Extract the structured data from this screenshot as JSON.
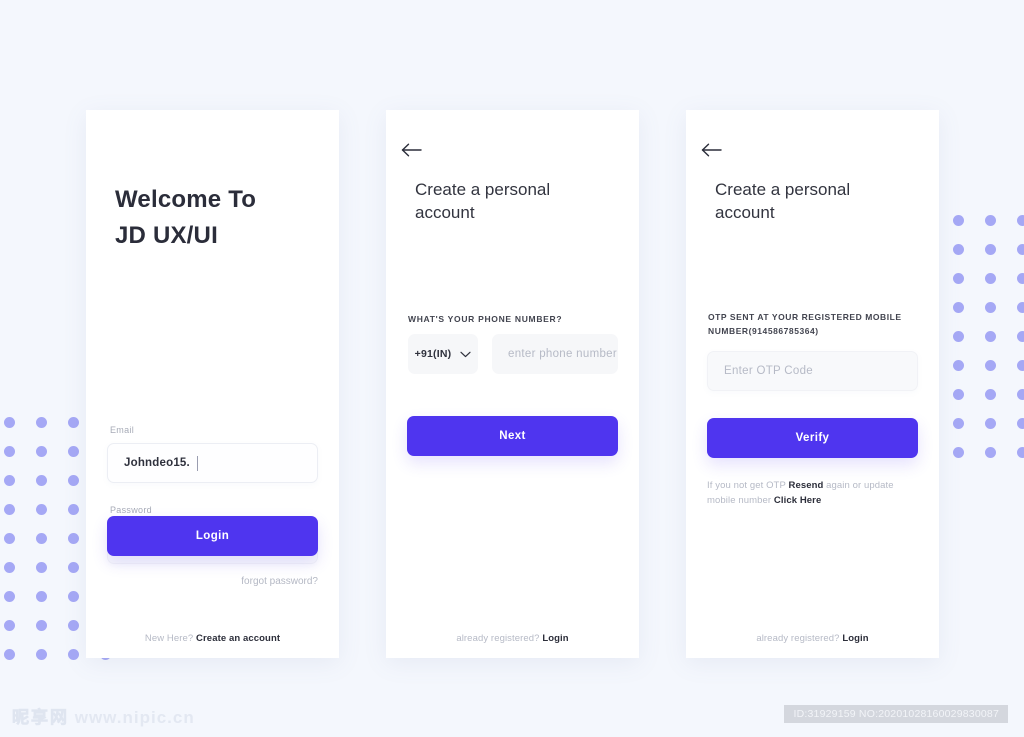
{
  "theme": {
    "accent": "#4f35ef",
    "background": "#f4f7fd",
    "card_background": "#ffffff",
    "dot_color": "#a5a8f5",
    "text_dark": "#2b2d3a",
    "text_muted": "#b6bac6"
  },
  "screens": {
    "login": {
      "title": "Welcome To\nJD UX/UI",
      "title_line1": "Welcome To",
      "title_line2": "JD UX/UI",
      "email": {
        "label": "Email",
        "value": "Johndeo15."
      },
      "password": {
        "label": "Password",
        "placeholder": "Password",
        "value": ""
      },
      "forgot_label": "forgot password?",
      "submit_label": "Login",
      "footer_text": "New Here?",
      "footer_link": "Create an account"
    },
    "phone": {
      "back_icon": "arrow-left-icon",
      "title_line1": "Create a personal",
      "title_line2": "account",
      "section_label": "WHAT'S YOUR PHONE NUMBER?",
      "country_code": "+91(IN)",
      "country_dropdown_icon": "chevron-down-icon",
      "phone_placeholder": "enter phone number",
      "phone_value": "",
      "submit_label": "Next",
      "footer_text": "already registered?",
      "footer_link": "Login"
    },
    "otp": {
      "back_icon": "arrow-left-icon",
      "title_line1": "Create a personal",
      "title_line2": "account",
      "note_line1": "OTP SENT AT YOUR REGISTERED MOBILE",
      "note_line2": "NUMBER(914586785364)",
      "otp_placeholder": "Enter OTP Code",
      "otp_value": "",
      "submit_label": "Verify",
      "help_prefix": "If you not get OTP",
      "help_resend": "Resend",
      "help_middle": "again or update mobile number",
      "help_click": "Click Here",
      "footer_text": "already registered?",
      "footer_link": "Login"
    }
  },
  "watermark": {
    "logo_cn": "昵享网",
    "logo_url": "www.nipic.cn",
    "id_text": "ID:31929159 NO:20201028160029830087"
  },
  "decor": {
    "dots_left_cols": 4,
    "dots_left_rows": 9,
    "dots_right_cols": 4,
    "dots_right_rows": 9
  }
}
